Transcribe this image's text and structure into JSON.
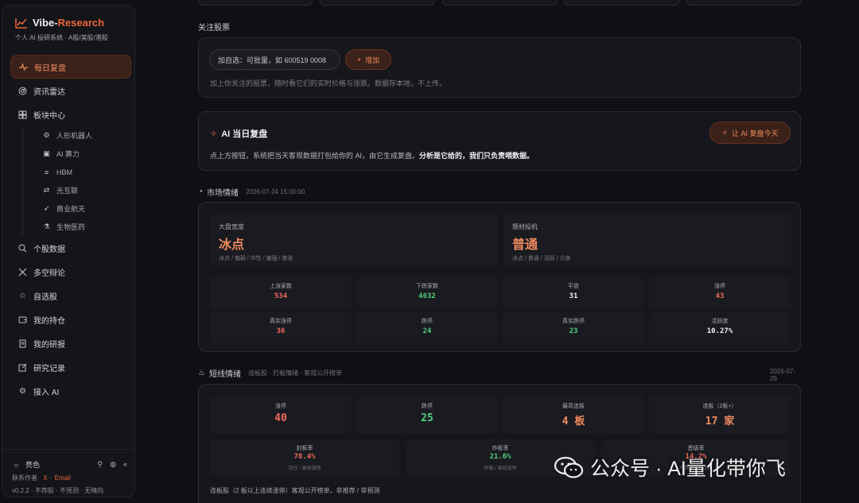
{
  "brand": {
    "title_main": "Vibe-",
    "title_accent": "Research",
    "subtitle": "个人 AI 投研系统 · A股/美股/港股"
  },
  "nav": {
    "daily": "每日复盘",
    "news": "资讯雷达",
    "sector": "板块中心",
    "sectors": [
      "人形机器人",
      "AI 算力",
      "HBM",
      "光互联",
      "商业航天",
      "生物医药"
    ],
    "stock": "个股数据",
    "debate": "多空辩论",
    "watchlist": "自选股",
    "holdings": "我的持仓",
    "reports": "我的研报",
    "records": "研究记录",
    "ai": "接入 AI"
  },
  "sidebar_footer": {
    "theme": "亮色",
    "contact": "联系作者",
    "x": "X",
    "email": "Email",
    "version": "v0.2.2 · 不荐股 · 不预测 · 无晴向"
  },
  "watch": {
    "label": "关注股票",
    "placeholder": "加自选：可批量，如 600519 0008",
    "add_label": "增加",
    "hint": "加上你关注的股票，随时看它们的实时价格与涨跌。数据存本地，不上传。"
  },
  "ai_review": {
    "title": "AI 当日复盘",
    "desc": "点上方按钮，系统把当天客观数据打包给你的 AI，由它生成复盘。",
    "desc_bold": "分析是它给的，我们只负责喂数据。",
    "button": "让 AI 复盘今天"
  },
  "market": {
    "label": "市场情绪",
    "timestamp": "2026-07-24 15:00:00",
    "breadth_label": "大盘宽度",
    "breadth_value": "冰点",
    "breadth_scale": "冰点 / 偏弱 / 中性 / 偏强 / 普涨",
    "spec_label": "题材投机",
    "spec_value": "普通",
    "spec_scale": "冰点 / 普通 / 活跃 / 亢奋",
    "stats": [
      {
        "label": "上涨家数",
        "value": "534"
      },
      {
        "label": "下跌家数",
        "value": "4632"
      },
      {
        "label": "平盘",
        "value": "31"
      },
      {
        "label": "涨停",
        "value": "43"
      },
      {
        "label": "真实涨停",
        "value": "36"
      },
      {
        "label": "跌停",
        "value": "24"
      },
      {
        "label": "真实跌停",
        "value": "23"
      },
      {
        "label": "活跃度",
        "value": "10.27%"
      }
    ]
  },
  "short": {
    "label": "短线情绪",
    "sub": "连板股 · 打板情绪 · 客观公开榜单",
    "date": "2026-07-26",
    "stats": [
      {
        "label": "涨停",
        "value": "40"
      },
      {
        "label": "跌停",
        "value": "25"
      },
      {
        "label": "最高连板",
        "value": "4 板"
      },
      {
        "label": "连板（2板+）",
        "value": "17 家"
      }
    ],
    "rates": [
      {
        "label": "封板率",
        "value": "78.4%",
        "sub": "封住 / 曾经涨停"
      },
      {
        "label": "炸板率",
        "value": "21.6%",
        "sub": "炸板 / 曾经涨停"
      },
      {
        "label": "晋级率",
        "value": "14.2%",
        "sub": "今晋级 / 昨连板"
      }
    ],
    "note": "连板股（2 板以上连续涨停）客观公开榜单，非推荐 / 非预测"
  },
  "watermark": {
    "text": "公众号 · AI量化带你飞"
  },
  "colors": {
    "accent": "#e8663a",
    "up": "#f06a5a",
    "down": "#4fcf7a",
    "bg": "#0f1013"
  }
}
